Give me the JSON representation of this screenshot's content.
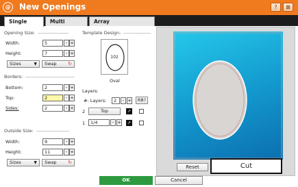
{
  "window": {
    "logo_text": "@",
    "title": "New Openings",
    "help_label": "?",
    "close_label": "⊠"
  },
  "tabs": [
    {
      "label": "Single"
    },
    {
      "label": "Multi"
    },
    {
      "label": "Array"
    }
  ],
  "opening_size": {
    "legend": "Opening Size:",
    "width_label": "Width:",
    "width_value": "5",
    "height_label": "Height:",
    "height_value": "7",
    "sizes_label": "Sizes",
    "swap_label": "Swap"
  },
  "borders": {
    "legend": "Borders:",
    "bottom_label": "Bottom:",
    "bottom_value": "2",
    "top_label": "Top:",
    "top_value": "2",
    "sides_label": "Sides:",
    "sides_value": "2"
  },
  "outside_size": {
    "legend": "Outside Size:",
    "width_label": "Width:",
    "width_value": "9",
    "height_label": "Height:",
    "height_value": "11",
    "sizes_label": "Sizes",
    "swap_label": "Swap"
  },
  "template": {
    "legend": "Template Design:",
    "number": "102",
    "name": "Oval"
  },
  "layers": {
    "legend": "Layers:",
    "count_label": "#: Layers:",
    "count_value": "2",
    "rb_label": "RB?",
    "rows": [
      {
        "index": "2",
        "value": "Top",
        "swatch": "↗"
      },
      {
        "index": "1",
        "value": "1/4",
        "swatch": "↗"
      }
    ]
  },
  "stepper": {
    "minus": "-",
    "plus": "+"
  },
  "canvas": {
    "reset_label": "Reset",
    "cut_label": "Cut"
  },
  "footer": {
    "ok_label": "OK",
    "cancel_label": "Cancel"
  },
  "colors": {
    "title_bar": "#f07a1e",
    "mat": "#1aa6d8",
    "ok": "#2e9a3f",
    "accent": "#d23a2a"
  }
}
